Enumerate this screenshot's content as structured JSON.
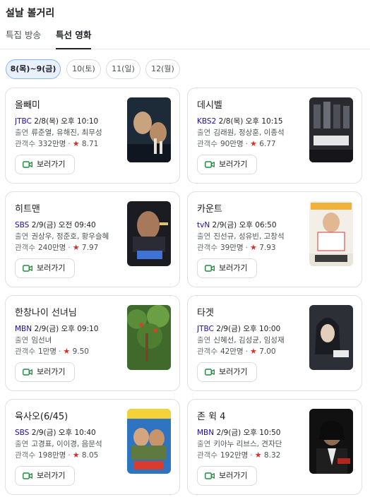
{
  "header": {
    "title": "설날 볼거리"
  },
  "tabs": [
    {
      "label": "특집 방송",
      "selected": false
    },
    {
      "label": "특선 영화",
      "selected": true
    }
  ],
  "date_chips": [
    {
      "label": "8(목)~9(금)",
      "selected": true
    },
    {
      "label": "10(토)",
      "selected": false
    },
    {
      "label": "11(일)",
      "selected": false
    },
    {
      "label": "12(월)",
      "selected": false
    }
  ],
  "movies": [
    {
      "title": "올빼미",
      "channel": "JTBC",
      "schedule": "2/8(목) 오후 10:10",
      "cast_label": "출연",
      "cast": "류준열, 유해진, 최무성",
      "audience_label": "관객수",
      "audience": "332만명",
      "rating": "8.71",
      "button_label": "보러가기",
      "poster_color": "#1d2a38"
    },
    {
      "title": "데시벨",
      "channel": "KBS2",
      "schedule": "2/8(목) 오후 10:15",
      "cast_label": "출연",
      "cast": "김래원, 정상훈, 이종석",
      "audience_label": "관객수",
      "audience": "90만명",
      "rating": "6.77",
      "button_label": "보러가기",
      "poster_color": "#2a2a2e"
    },
    {
      "title": "히트맨",
      "channel": "SBS",
      "schedule": "2/9(금) 오전 09:40",
      "cast_label": "출연",
      "cast": "권상우, 정준호, 황우슬혜",
      "audience_label": "관객수",
      "audience": "240만명",
      "rating": "7.97",
      "button_label": "보러가기",
      "poster_color": "#1b1b22"
    },
    {
      "title": "카운트",
      "channel": "tvN",
      "schedule": "2/9(금) 오후 06:50",
      "cast_label": "출연",
      "cast": "진선규, 성유빈, 고창석",
      "audience_label": "관객수",
      "audience": "39만명",
      "rating": "7.93",
      "button_label": "보러가기",
      "poster_color": "#f2efe8"
    },
    {
      "title": "한창나이 선녀님",
      "channel": "MBN",
      "schedule": "2/9(금) 오후 09:10",
      "cast_label": "출연",
      "cast": "임선녀",
      "audience_label": "관객수",
      "audience": "1만명",
      "rating": "9.50",
      "button_label": "보러가기",
      "poster_color": "#3f6a2c"
    },
    {
      "title": "타겟",
      "channel": "JTBC",
      "schedule": "2/9(금) 오후 10:00",
      "cast_label": "출연",
      "cast": "신혜선, 김성균, 임성재",
      "audience_label": "관객수",
      "audience": "42만명",
      "rating": "7.00",
      "button_label": "보러가기",
      "poster_color": "#2c2f36"
    },
    {
      "title": "육사오(6/45)",
      "channel": "SBS",
      "schedule": "2/9(금) 오후 10:40",
      "cast_label": "출연",
      "cast": "고경표, 이이경, 음문석",
      "audience_label": "관객수",
      "audience": "198만명",
      "rating": "8.05",
      "button_label": "보러가기",
      "poster_color": "#2f74c0"
    },
    {
      "title": "존 윅 4",
      "channel": "MBN",
      "schedule": "2/9(금) 오후 10:50",
      "cast_label": "출연",
      "cast": "키아누 리브스, 견자단",
      "audience_label": "관객수",
      "audience": "192만명",
      "rating": "8.32",
      "button_label": "보러가기",
      "poster_color": "#111111"
    }
  ],
  "icons": {
    "watch": "video-camera-icon",
    "star": "star-icon"
  },
  "colors": {
    "channel_link": "#1a0dab",
    "star": "#d93025",
    "watch_icon": "#1e8e3e",
    "selected_chip_bg": "#e8f0fe"
  }
}
